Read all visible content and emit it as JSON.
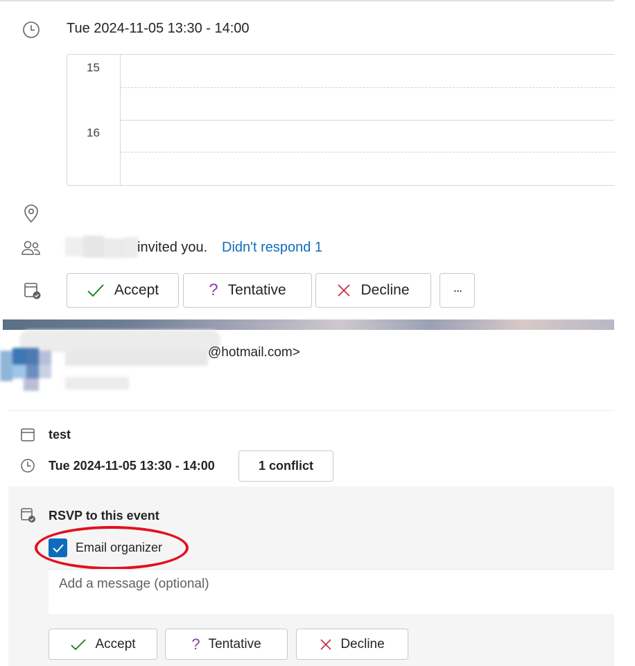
{
  "meeting": {
    "datetime": "Tue 2024-11-05 13:30 - 14:00",
    "calendar_hours": [
      "15",
      "16"
    ],
    "invite_text": "invited you.",
    "response_status": "Didn't respond 1"
  },
  "response_buttons": {
    "accept": "Accept",
    "tentative": "Tentative",
    "decline": "Decline",
    "more": "···"
  },
  "sender": {
    "email_suffix": "@hotmail.com>"
  },
  "event_card": {
    "title": "test",
    "datetime": "Tue 2024-11-05 13:30 - 14:00",
    "conflict_label": "1 conflict",
    "rsvp_heading": "RSVP to this event",
    "email_organizer_label": "Email organizer",
    "email_organizer_checked": true,
    "message_placeholder": "Add a message (optional)",
    "accept": "Accept",
    "tentative": "Tentative",
    "decline": "Decline"
  },
  "colors": {
    "accent": "#0f6cbd",
    "accept_green": "#107c10",
    "tentative_purple": "#8a3fa8",
    "decline_red": "#c4314b",
    "annotation_red": "#e3101e"
  }
}
